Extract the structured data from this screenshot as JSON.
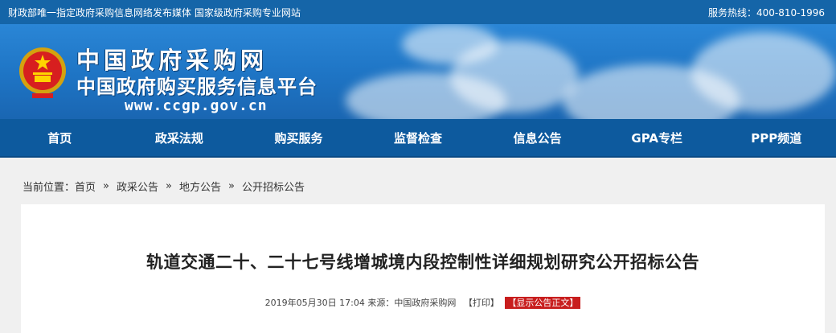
{
  "topbar": {
    "tagline": "财政部唯一指定政府采购信息网络发布媒体  国家级政府采购专业网站",
    "hotline": "服务热线：400-810-1996"
  },
  "banner": {
    "site_name": "中国政府采购网",
    "site_subtitle": "中国政府购买服务信息平台",
    "url": "www.ccgp.gov.cn",
    "emblem_icon": "national-emblem-icon"
  },
  "nav": {
    "items": [
      "首页",
      "政采法规",
      "购买服务",
      "监督检查",
      "信息公告",
      "GPA专栏",
      "PPP频道"
    ]
  },
  "breadcrumb": {
    "label": "当前位置：",
    "items": [
      "首页",
      "政采公告",
      "地方公告",
      "公开招标公告"
    ],
    "separator": "»"
  },
  "article": {
    "title": "轨道交通二十、二十七号线增城境内段控制性详细规划研究公开招标公告",
    "date": "2019年05月30日 17:04",
    "source": "来源：中国政府采购网",
    "print_label": "【打印】",
    "show_body_label": "【显示公告正文】"
  },
  "colors": {
    "topbar": "#1565a8",
    "nav": "#0d5a9e",
    "accent_red": "#c81e1e"
  }
}
